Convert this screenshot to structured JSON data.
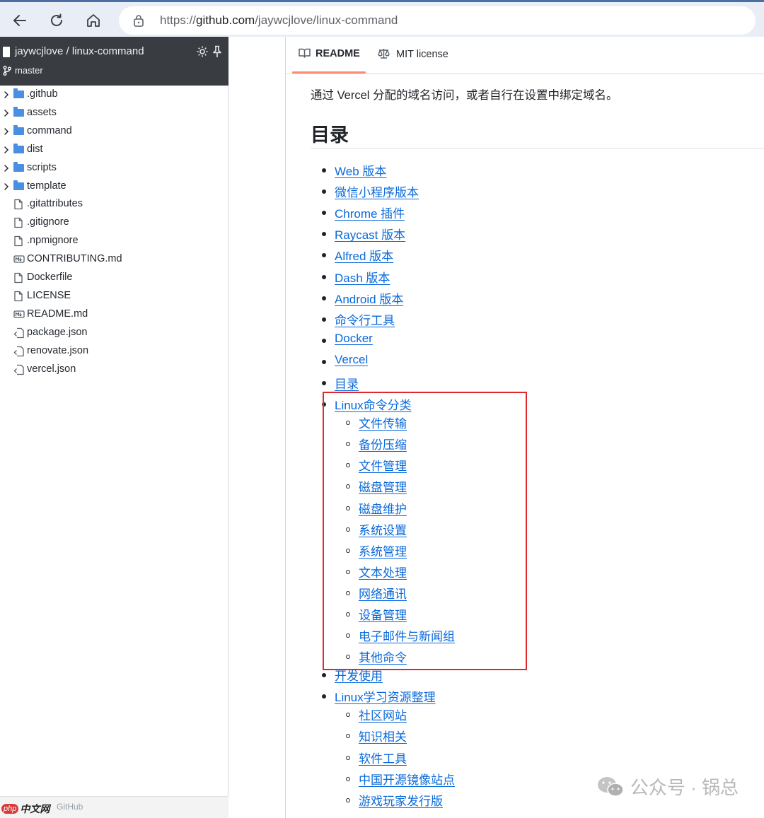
{
  "browser": {
    "url_prefix": "https://",
    "url_host": "github.com",
    "url_path": "/jaywcjlove/linux-command"
  },
  "sidebar": {
    "repo_name": "jaywcjlove / linux-command",
    "branch": "master",
    "items": [
      {
        "label": ".github",
        "type": "folder"
      },
      {
        "label": "assets",
        "type": "folder"
      },
      {
        "label": "command",
        "type": "folder"
      },
      {
        "label": "dist",
        "type": "folder"
      },
      {
        "label": "scripts",
        "type": "folder"
      },
      {
        "label": "template",
        "type": "folder"
      },
      {
        "label": ".gitattributes",
        "type": "file"
      },
      {
        "label": ".gitignore",
        "type": "file"
      },
      {
        "label": ".npmignore",
        "type": "file"
      },
      {
        "label": "CONTRIBUTING.md",
        "type": "markdown"
      },
      {
        "label": "Dockerfile",
        "type": "file"
      },
      {
        "label": "LICENSE",
        "type": "file"
      },
      {
        "label": "README.md",
        "type": "markdown"
      },
      {
        "label": "package.json",
        "type": "json"
      },
      {
        "label": "renovate.json",
        "type": "json"
      },
      {
        "label": "vercel.json",
        "type": "json"
      }
    ],
    "footer": "GitHub"
  },
  "tabs": {
    "readme": "README",
    "license": "MIT license"
  },
  "readme": {
    "intro": "通过 Vercel 分配的域名访问，或者自行在设置中绑定域名。",
    "heading": "目录",
    "toc": [
      {
        "label": "Web 版本",
        "level": 1
      },
      {
        "label": "微信小程序版本",
        "level": 1
      },
      {
        "label": "Chrome 插件",
        "level": 1
      },
      {
        "label": "Raycast 版本",
        "level": 1
      },
      {
        "label": "Alfred 版本",
        "level": 1
      },
      {
        "label": "Dash 版本",
        "level": 1
      },
      {
        "label": "Android 版本",
        "level": 1
      },
      {
        "label": "命令行工具",
        "level": 1
      },
      {
        "label": "Docker",
        "level": 1
      },
      {
        "label": "Vercel",
        "level": 1
      },
      {
        "label": "目录",
        "level": 1
      },
      {
        "label": "Linux命令分类",
        "level": 1
      },
      {
        "label": "文件传输",
        "level": 2
      },
      {
        "label": "备份压缩",
        "level": 2
      },
      {
        "label": "文件管理",
        "level": 2
      },
      {
        "label": "磁盘管理",
        "level": 2
      },
      {
        "label": "磁盘维护",
        "level": 2
      },
      {
        "label": "系统设置",
        "level": 2
      },
      {
        "label": "系统管理",
        "level": 2
      },
      {
        "label": "文本处理",
        "level": 2
      },
      {
        "label": "网络通讯",
        "level": 2
      },
      {
        "label": "设备管理",
        "level": 2
      },
      {
        "label": "电子邮件与新闻组",
        "level": 2
      },
      {
        "label": "其他命令",
        "level": 2
      },
      {
        "label": "开发使用",
        "level": 1
      },
      {
        "label": "Linux学习资源整理",
        "level": 1
      },
      {
        "label": "社区网站",
        "level": 2
      },
      {
        "label": "知识相关",
        "level": 2
      },
      {
        "label": "软件工具",
        "level": 2
      },
      {
        "label": "中国开源镜像站点",
        "level": 2
      },
      {
        "label": "游戏玩家发行版",
        "level": 2
      }
    ]
  },
  "watermark": {
    "right_text": "公众号 · 锅总",
    "left_php": "php",
    "left_cn": "中文网"
  },
  "colors": {
    "link": "#0969da",
    "highlight_box": "#e0282f",
    "tab_underline": "#fd8c73",
    "sidebar_header": "#393d41",
    "folder": "#4a90e2"
  }
}
